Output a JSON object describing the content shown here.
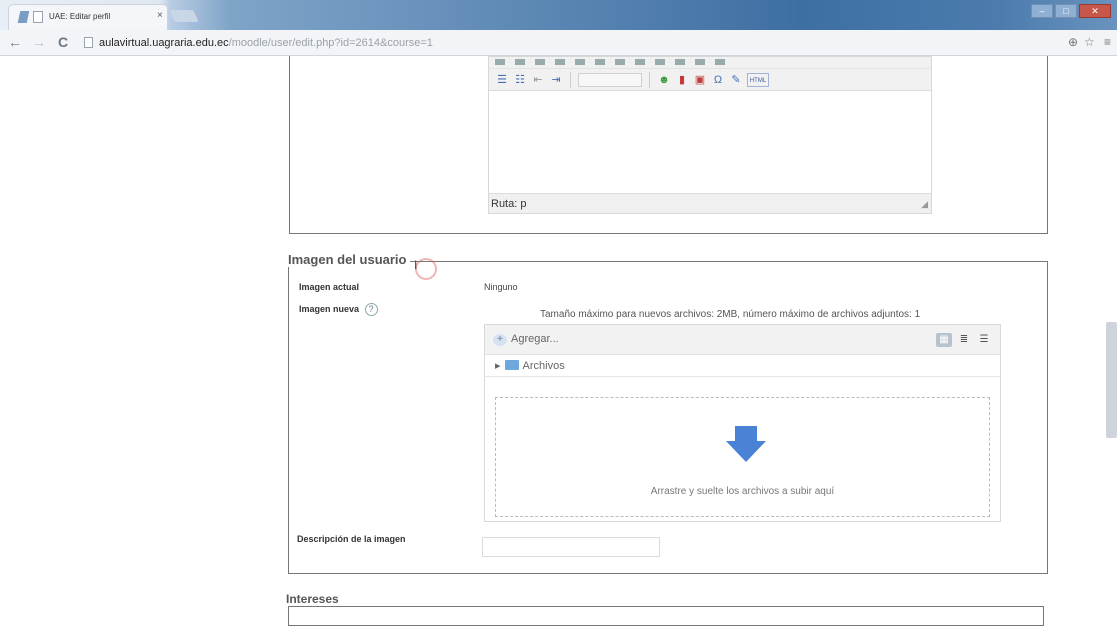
{
  "browser": {
    "tab_title": "UAE: Editar perfil",
    "tab_close": "×",
    "url_host": "aulavirtual.uagraria.edu.ec",
    "url_path": "/moodle/user/edit.php?id=2614&course=1"
  },
  "editor": {
    "path_label": "Ruta: p"
  },
  "user_image": {
    "legend": "Imagen del usuario",
    "current_label": "Imagen actual",
    "current_value": "Ninguno",
    "new_label": "Imagen nueva",
    "help_icon": "?",
    "max_info": "Tamaño máximo para nuevos archivos: 2MB, número máximo de archivos adjuntos: 1",
    "add_label": "Agregar...",
    "folder_label": "Archivos",
    "drop_text": "Arrastre y suelte los archivos a subir aquí",
    "description_label": "Descripción de la imagen",
    "description_value": ""
  },
  "interests": {
    "legend": "Intereses"
  },
  "icons": {
    "back": "back-arrow-icon",
    "forward": "forward-arrow-icon",
    "reload": "reload-icon",
    "zoom": "zoom-icon",
    "bookmark": "star-icon",
    "menu": "menu-icon",
    "drop_arrow": "down-arrow-icon"
  },
  "colors": {
    "drop_arrow": "#4a82d6",
    "folder": "#6fa8dc"
  }
}
